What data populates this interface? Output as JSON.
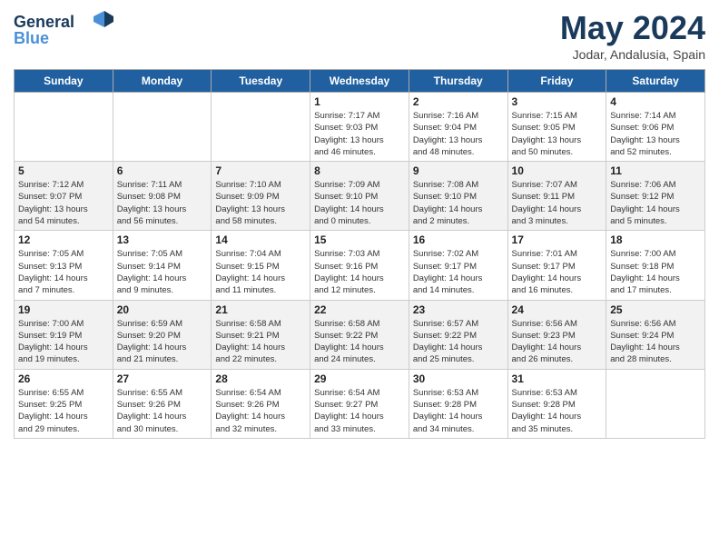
{
  "header": {
    "logo_line1": "General",
    "logo_line2": "Blue",
    "month_year": "May 2024",
    "location": "Jodar, Andalusia, Spain"
  },
  "weekdays": [
    "Sunday",
    "Monday",
    "Tuesday",
    "Wednesday",
    "Thursday",
    "Friday",
    "Saturday"
  ],
  "weeks": [
    [
      {
        "day": "",
        "info": ""
      },
      {
        "day": "",
        "info": ""
      },
      {
        "day": "",
        "info": ""
      },
      {
        "day": "1",
        "info": "Sunrise: 7:17 AM\nSunset: 9:03 PM\nDaylight: 13 hours\nand 46 minutes."
      },
      {
        "day": "2",
        "info": "Sunrise: 7:16 AM\nSunset: 9:04 PM\nDaylight: 13 hours\nand 48 minutes."
      },
      {
        "day": "3",
        "info": "Sunrise: 7:15 AM\nSunset: 9:05 PM\nDaylight: 13 hours\nand 50 minutes."
      },
      {
        "day": "4",
        "info": "Sunrise: 7:14 AM\nSunset: 9:06 PM\nDaylight: 13 hours\nand 52 minutes."
      }
    ],
    [
      {
        "day": "5",
        "info": "Sunrise: 7:12 AM\nSunset: 9:07 PM\nDaylight: 13 hours\nand 54 minutes."
      },
      {
        "day": "6",
        "info": "Sunrise: 7:11 AM\nSunset: 9:08 PM\nDaylight: 13 hours\nand 56 minutes."
      },
      {
        "day": "7",
        "info": "Sunrise: 7:10 AM\nSunset: 9:09 PM\nDaylight: 13 hours\nand 58 minutes."
      },
      {
        "day": "8",
        "info": "Sunrise: 7:09 AM\nSunset: 9:10 PM\nDaylight: 14 hours\nand 0 minutes."
      },
      {
        "day": "9",
        "info": "Sunrise: 7:08 AM\nSunset: 9:10 PM\nDaylight: 14 hours\nand 2 minutes."
      },
      {
        "day": "10",
        "info": "Sunrise: 7:07 AM\nSunset: 9:11 PM\nDaylight: 14 hours\nand 3 minutes."
      },
      {
        "day": "11",
        "info": "Sunrise: 7:06 AM\nSunset: 9:12 PM\nDaylight: 14 hours\nand 5 minutes."
      }
    ],
    [
      {
        "day": "12",
        "info": "Sunrise: 7:05 AM\nSunset: 9:13 PM\nDaylight: 14 hours\nand 7 minutes."
      },
      {
        "day": "13",
        "info": "Sunrise: 7:05 AM\nSunset: 9:14 PM\nDaylight: 14 hours\nand 9 minutes."
      },
      {
        "day": "14",
        "info": "Sunrise: 7:04 AM\nSunset: 9:15 PM\nDaylight: 14 hours\nand 11 minutes."
      },
      {
        "day": "15",
        "info": "Sunrise: 7:03 AM\nSunset: 9:16 PM\nDaylight: 14 hours\nand 12 minutes."
      },
      {
        "day": "16",
        "info": "Sunrise: 7:02 AM\nSunset: 9:17 PM\nDaylight: 14 hours\nand 14 minutes."
      },
      {
        "day": "17",
        "info": "Sunrise: 7:01 AM\nSunset: 9:17 PM\nDaylight: 14 hours\nand 16 minutes."
      },
      {
        "day": "18",
        "info": "Sunrise: 7:00 AM\nSunset: 9:18 PM\nDaylight: 14 hours\nand 17 minutes."
      }
    ],
    [
      {
        "day": "19",
        "info": "Sunrise: 7:00 AM\nSunset: 9:19 PM\nDaylight: 14 hours\nand 19 minutes."
      },
      {
        "day": "20",
        "info": "Sunrise: 6:59 AM\nSunset: 9:20 PM\nDaylight: 14 hours\nand 21 minutes."
      },
      {
        "day": "21",
        "info": "Sunrise: 6:58 AM\nSunset: 9:21 PM\nDaylight: 14 hours\nand 22 minutes."
      },
      {
        "day": "22",
        "info": "Sunrise: 6:58 AM\nSunset: 9:22 PM\nDaylight: 14 hours\nand 24 minutes."
      },
      {
        "day": "23",
        "info": "Sunrise: 6:57 AM\nSunset: 9:22 PM\nDaylight: 14 hours\nand 25 minutes."
      },
      {
        "day": "24",
        "info": "Sunrise: 6:56 AM\nSunset: 9:23 PM\nDaylight: 14 hours\nand 26 minutes."
      },
      {
        "day": "25",
        "info": "Sunrise: 6:56 AM\nSunset: 9:24 PM\nDaylight: 14 hours\nand 28 minutes."
      }
    ],
    [
      {
        "day": "26",
        "info": "Sunrise: 6:55 AM\nSunset: 9:25 PM\nDaylight: 14 hours\nand 29 minutes."
      },
      {
        "day": "27",
        "info": "Sunrise: 6:55 AM\nSunset: 9:26 PM\nDaylight: 14 hours\nand 30 minutes."
      },
      {
        "day": "28",
        "info": "Sunrise: 6:54 AM\nSunset: 9:26 PM\nDaylight: 14 hours\nand 32 minutes."
      },
      {
        "day": "29",
        "info": "Sunrise: 6:54 AM\nSunset: 9:27 PM\nDaylight: 14 hours\nand 33 minutes."
      },
      {
        "day": "30",
        "info": "Sunrise: 6:53 AM\nSunset: 9:28 PM\nDaylight: 14 hours\nand 34 minutes."
      },
      {
        "day": "31",
        "info": "Sunrise: 6:53 AM\nSunset: 9:28 PM\nDaylight: 14 hours\nand 35 minutes."
      },
      {
        "day": "",
        "info": ""
      }
    ]
  ]
}
